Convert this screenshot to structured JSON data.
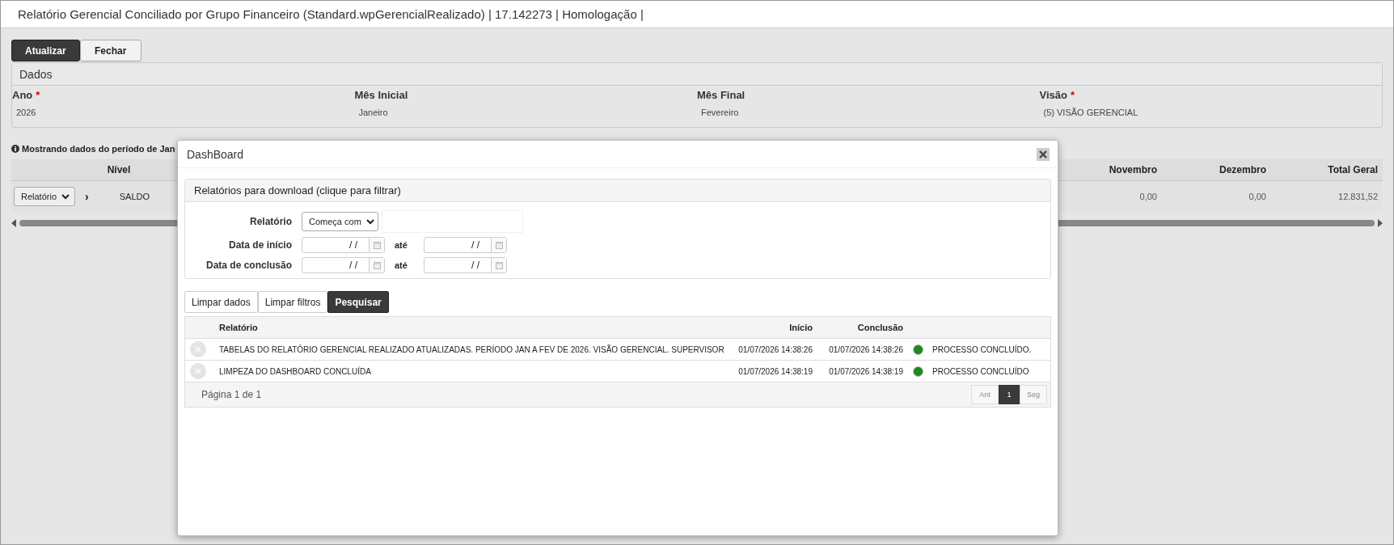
{
  "window": {
    "title": "Relatório Gerencial Conciliado por Grupo Financeiro (Standard.wpGerencialRealizado) | 17.142273 | Homologação |"
  },
  "toolbar": [
    {
      "label": "Atualizar",
      "kind": "primary"
    },
    {
      "label": "Fechar",
      "kind": "default"
    }
  ],
  "dados": {
    "title": "Dados",
    "fields": [
      {
        "label": "Ano",
        "required_mark": "*",
        "value": "2026"
      },
      {
        "label": "Mês Inicial",
        "value": "Janeiro"
      },
      {
        "label": "Mês Final",
        "value": "Fevereiro"
      },
      {
        "label": "Visão",
        "required_mark": "*",
        "value": "(5) VISÃO GERENCIAL"
      }
    ]
  },
  "info": "Mostrando dados do período de Jan",
  "grid": {
    "columns": [
      "Nível",
      "Novembro",
      "Dezembro",
      "Total Geral"
    ],
    "rows": [
      {
        "select": "Relatório",
        "chevron": "›",
        "nivel": "SALDO",
        "values": [
          "0,00",
          "0,00",
          "12.831,52"
        ]
      }
    ]
  },
  "dialog": {
    "title": "DashBoard",
    "filters": {
      "title": "Relatórios para download (clique para filtrar)",
      "report": {
        "label": "Relatório",
        "operator": "Começa com"
      },
      "dates": [
        {
          "label": "Data de início",
          "from": "/ /",
          "joiner": "até",
          "to": "/ /"
        },
        {
          "label": "Data de conclusão",
          "from": "/ /",
          "joiner": "até",
          "to": "/ /"
        }
      ]
    },
    "buttons": [
      {
        "label": "Limpar dados",
        "kind": "default"
      },
      {
        "label": "Limpar filtros",
        "kind": "default"
      },
      {
        "label": "Pesquisar",
        "kind": "primary"
      }
    ],
    "table": {
      "columns": [
        "Relatório",
        "Início",
        "Conclusão"
      ],
      "rows": [
        {
          "report": "TABELAS DO RELATÓRIO GERENCIAL REALIZADO ATUALIZADAS. PERÍODO JAN A FEV DE 2026. VISÃO GERENCIAL. SUPERVISOR",
          "start": "01/07/2026 14:38:26",
          "end": "01/07/2026 14:38:26",
          "color": "#1f8a1f",
          "status": "PROCESSO CONCLUÍDO."
        },
        {
          "report": "LIMPEZA DO DASHBOARD CONCLUÍDA",
          "start": "01/07/2026 14:38:19",
          "end": "01/07/2026 14:38:19",
          "color": "#1f8a1f",
          "status": "PROCESSO CONCLUÍDO"
        }
      ]
    },
    "footer": "Página 1 de 1",
    "pager": [
      {
        "label": "Ant",
        "selected": false
      },
      {
        "label": "1",
        "selected": true
      },
      {
        "label": "Seg",
        "selected": false
      }
    ]
  }
}
